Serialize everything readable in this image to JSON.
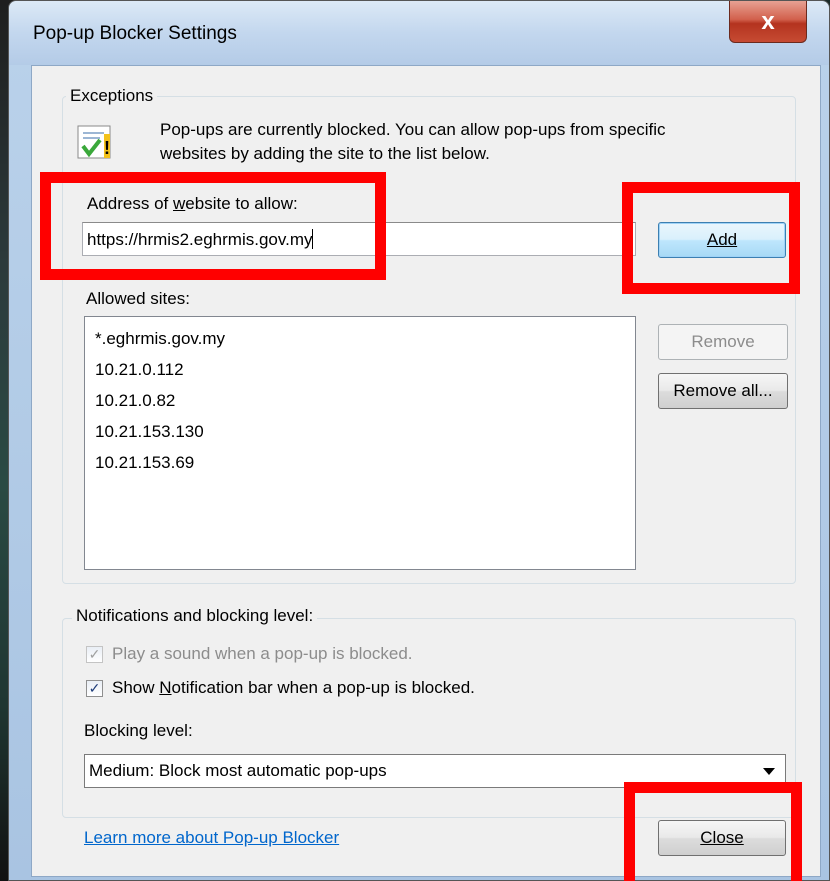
{
  "window": {
    "title": "Pop-up Blocker Settings",
    "close_label": "x"
  },
  "exceptions": {
    "legend": "Exceptions",
    "info_text_1": "Pop-ups are currently blocked.  You can allow pop-ups from specific",
    "info_text_2": "websites by adding the site to the list below.",
    "address_label_pre": "Address of ",
    "address_label_accel": "w",
    "address_label_post": "ebsite to allow:",
    "address_value": "https://hrmis2.eghrmis.gov.my",
    "add_label": "Add",
    "allowed_label": "Allowed sites:",
    "allowed_sites": [
      "*.eghrmis.gov.my",
      "10.21.0.112",
      "10.21.0.82",
      "10.21.153.130",
      "10.21.153.69"
    ],
    "remove_label": "Remove",
    "remove_all_label": "Remove all..."
  },
  "notifications": {
    "legend": "Notifications and blocking level:",
    "play_sound_label": "Play a sound when a pop-up is blocked.",
    "play_sound_checked": true,
    "show_bar_pre": "Show ",
    "show_bar_accel": "N",
    "show_bar_post": "otification bar when a pop-up is blocked.",
    "show_bar_checked": true,
    "blocking_level_label": "Blocking level:",
    "blocking_level_value": "Medium: Block most automatic pop-ups"
  },
  "footer": {
    "learn_more": "Learn more about Pop-up Blocker",
    "close_label": "Close"
  },
  "highlight_color": "#ff0000"
}
